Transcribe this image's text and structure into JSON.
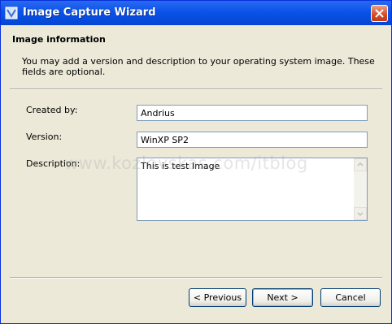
{
  "window": {
    "title": "Image Capture Wizard"
  },
  "header": {
    "title": "Image information",
    "description": "You may add a version and description to your operating system image.  These fields are optional."
  },
  "form": {
    "created_by": {
      "label": "Created by:",
      "value": "Andrius"
    },
    "version": {
      "label": "Version:",
      "value": "WinXP SP2"
    },
    "description": {
      "label": "Description:",
      "value": "This is test Image"
    }
  },
  "watermark": "www.kozlovskas.com/itblog",
  "buttons": {
    "previous": "< Previous",
    "next": "Next >",
    "cancel": "Cancel"
  },
  "icons": {
    "app": "wizard-icon",
    "close": "close-icon"
  },
  "colors": {
    "titlebar": "#0A53E8",
    "face": "#ECE9D8",
    "close": "#D64A25"
  }
}
